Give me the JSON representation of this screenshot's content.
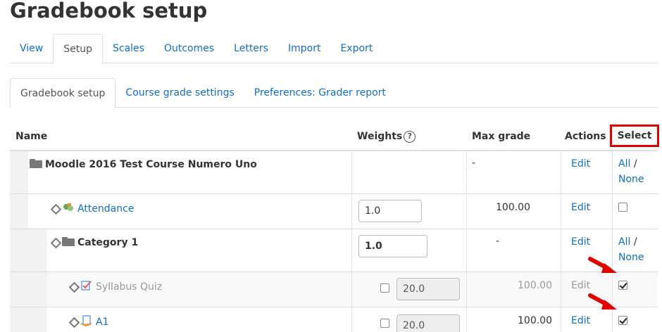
{
  "page": {
    "title": "Gradebook setup"
  },
  "main_tabs": [
    {
      "label": "View"
    },
    {
      "label": "Setup"
    },
    {
      "label": "Scales"
    },
    {
      "label": "Outcomes"
    },
    {
      "label": "Letters"
    },
    {
      "label": "Import"
    },
    {
      "label": "Export"
    }
  ],
  "sub_tabs": [
    {
      "label": "Gradebook setup"
    },
    {
      "label": "Course grade settings"
    },
    {
      "label": "Preferences: Grader report"
    }
  ],
  "table": {
    "headers": {
      "name": "Name",
      "weights": "Weights",
      "weights_help": "?",
      "max_grade": "Max grade",
      "actions": "Actions",
      "select": "Select"
    },
    "rows": [
      {
        "name": "Moodle 2016 Test Course Numero Uno",
        "max_grade": "-",
        "action": "Edit",
        "select_all": "All",
        "select_sep": "/",
        "select_none": "None"
      },
      {
        "name": "Attendance",
        "weight": "1.0",
        "max_grade": "100.00",
        "action": "Edit"
      },
      {
        "name": "Category 1",
        "weight": "1.0",
        "max_grade": "-",
        "action": "Edit",
        "select_all": "All",
        "select_sep": "/",
        "select_none": "None"
      },
      {
        "name": "Syllabus Quiz",
        "weight": "20.0",
        "max_grade": "100.00",
        "action": "Edit",
        "checked": true
      },
      {
        "name": "A1",
        "weight": "20.0",
        "max_grade": "100.00",
        "action": "Edit",
        "checked": true
      }
    ]
  },
  "colors": {
    "link": "#0f6fc5",
    "highlight": "#dd0000",
    "arrow": "#e00000"
  }
}
